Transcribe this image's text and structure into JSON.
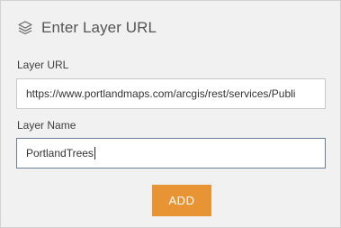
{
  "header": {
    "title": "Enter Layer URL",
    "icon": "layers-icon"
  },
  "layer_url": {
    "label": "Layer URL",
    "value": "https://www.portlandmaps.com/arcgis/rest/services/Publi"
  },
  "layer_name": {
    "label": "Layer Name",
    "value": "PortlandTrees"
  },
  "add_button": {
    "label": "ADD",
    "color": "#e99434"
  }
}
